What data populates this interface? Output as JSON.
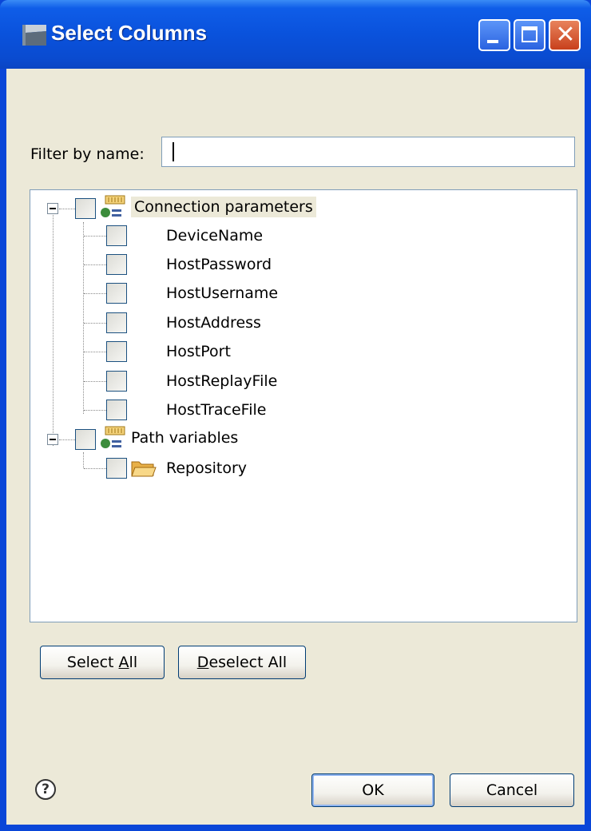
{
  "window": {
    "title": "Select Columns",
    "controls": {
      "minimize_icon": "minimize-icon",
      "maximize_icon": "maximize-icon",
      "close_icon": "close-icon"
    }
  },
  "filter": {
    "label": "Filter by name:",
    "value": ""
  },
  "tree": {
    "groups": [
      {
        "label": "Connection parameters",
        "icon": "parameter-group-icon",
        "expanded": true,
        "children": [
          "DeviceName",
          "HostPassword",
          "HostUsername",
          "HostAddress",
          "HostPort",
          "HostReplayFile",
          "HostTraceFile"
        ]
      },
      {
        "label": "Path variables",
        "icon": "parameter-group-icon",
        "expanded": true,
        "children": [
          "Repository"
        ],
        "child_icon": "folder-icon"
      }
    ]
  },
  "buttons": {
    "select_all": {
      "pre": "Select ",
      "mn": "A",
      "post": "ll"
    },
    "deselect_all": {
      "pre": "",
      "mn": "D",
      "post": "eselect All"
    },
    "ok": "OK",
    "cancel": "Cancel"
  },
  "help_icon": "help-icon",
  "colors": {
    "titlebar": "#0a52dc",
    "dialog_bg": "#ece9d8",
    "close_button": "#c8401c"
  }
}
